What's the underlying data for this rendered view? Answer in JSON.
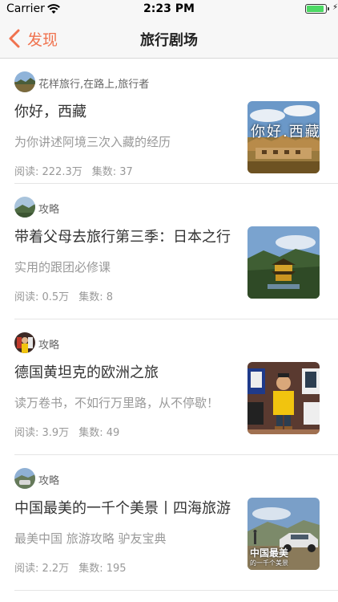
{
  "status_bar": {
    "carrier": "Carrier",
    "time": "2:23 PM",
    "battery_level": 0.9,
    "battery_color": "#4cd964"
  },
  "nav": {
    "back_label": "发现",
    "title": "旅行剧场",
    "accent_color": "#f0724e"
  },
  "items": [
    {
      "author": "花样旅行,在路上,旅行者",
      "title": "你好，西藏",
      "desc": "为你讲述阿境三次入藏的经历",
      "reads_label": "阅读: 222.3万",
      "episodes_label": "集数: 37",
      "thumb_caption": "你好.西藏",
      "thumb_icon": "tibet-landscape-thumbnail"
    },
    {
      "author": "攻略",
      "title": "带着父母去旅行第三季：日本之行",
      "desc": "实用的跟团必修课",
      "reads_label": "阅读: 0.5万",
      "episodes_label": "集数: 8",
      "thumb_icon": "golden-pavilion-thumbnail"
    },
    {
      "author": "攻略",
      "title": "德国黄坦克的欧洲之旅",
      "desc": "读万卷书，不如行万里路，从不停歇！",
      "reads_label": "阅读: 3.9万",
      "episodes_label": "集数: 49",
      "thumb_icon": "football-jerseys-thumbnail"
    },
    {
      "author": "攻略",
      "title": "中国最美的一千个美景丨四海旅游",
      "desc": "最美中国 旅游攻略 驴友宝典",
      "reads_label": "阅读: 2.2万",
      "episodes_label": "集数: 195",
      "thumb_caption": "中国最美",
      "thumb_caption_small": "的一千个美景",
      "thumb_icon": "car-landscape-thumbnail"
    }
  ]
}
